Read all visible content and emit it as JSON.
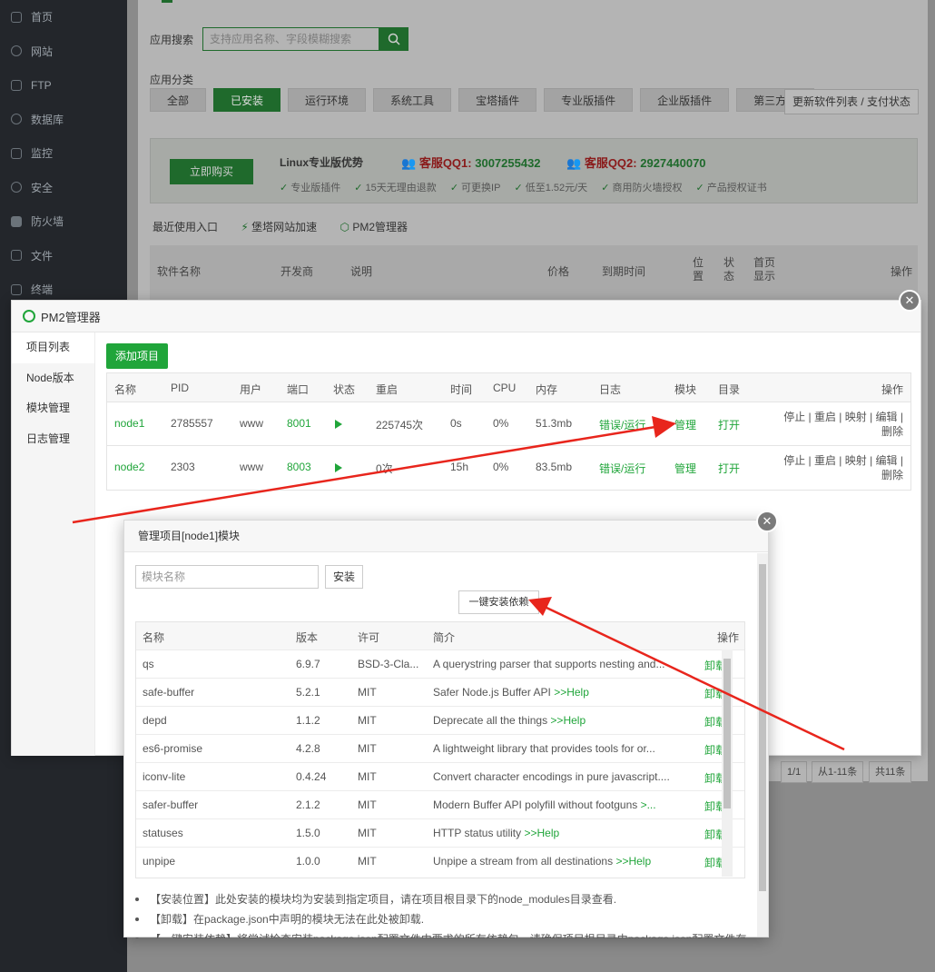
{
  "sidebar": {
    "items": [
      {
        "label": "首页",
        "icon": "home-icon"
      },
      {
        "label": "网站",
        "icon": "globe-icon"
      },
      {
        "label": "FTP",
        "icon": "ftp-icon"
      },
      {
        "label": "数据库",
        "icon": "database-icon"
      },
      {
        "label": "监控",
        "icon": "monitor-icon"
      },
      {
        "label": "安全",
        "icon": "shield-icon"
      },
      {
        "label": "防火墙",
        "icon": "firewall-icon"
      },
      {
        "label": "文件",
        "icon": "folder-icon"
      },
      {
        "label": "终端",
        "icon": "terminal-icon"
      }
    ]
  },
  "store": {
    "search_label": "应用搜索",
    "search_placeholder": "支持应用名称、字段模糊搜索",
    "category_label": "应用分类",
    "categories": [
      "全部",
      "已安装",
      "运行环境",
      "系统工具",
      "宝塔插件",
      "专业版插件",
      "企业版插件",
      "第三方应"
    ],
    "update_button": "更新软件列表 / 支付状态",
    "promo": {
      "buy": "立即购买",
      "title": "Linux专业版优势",
      "qq1_label": "客服QQ1:",
      "qq1": "3007255432",
      "qq2_label": "客服QQ2:",
      "qq2": "2927440070",
      "features": [
        "专业版插件",
        "15天无理由退款",
        "可更换IP",
        "低至1.52元/天",
        "商用防火墙授权",
        "产品授权证书"
      ]
    },
    "recent_label": "最近使用入口",
    "recent": [
      "堡塔网站加速",
      "PM2管理器"
    ],
    "table_headers": [
      "软件名称",
      "开发商",
      "说明",
      "价格",
      "到期时间",
      "位置",
      "状态",
      "首页显示",
      "操作"
    ]
  },
  "pm2": {
    "title": "PM2管理器",
    "menu": [
      "项目列表",
      "Node版本",
      "模块管理",
      "日志管理"
    ],
    "add_button": "添加项目",
    "headers": [
      "名称",
      "PID",
      "用户",
      "端口",
      "状态",
      "重启",
      "时间",
      "CPU",
      "内存",
      "日志",
      "模块",
      "目录",
      "操作"
    ],
    "rows": [
      {
        "name": "node1",
        "pid": "2785557",
        "user": "www",
        "port": "8001",
        "restart": "225745次",
        "time": "0s",
        "cpu": "0%",
        "mem": "51.3mb",
        "log": "错误/运行",
        "module": "管理",
        "dir": "打开",
        "ops1": "停止 | 重启 | 映射 | 编辑 |",
        "ops2": "删除"
      },
      {
        "name": "node2",
        "pid": "2303",
        "user": "www",
        "port": "8003",
        "restart": "0次",
        "time": "15h",
        "cpu": "0%",
        "mem": "83.5mb",
        "log": "错误/运行",
        "module": "管理",
        "dir": "打开",
        "ops1": "停止 | 重启 | 映射 | 编辑 |",
        "ops2": "删除"
      }
    ]
  },
  "pager": {
    "page": "1/1",
    "range": "从1-11条",
    "total": "共11条"
  },
  "module_dialog": {
    "title": "管理项目[node1]模块",
    "input_placeholder": "模块名称",
    "install_button": "安装",
    "one_key_button": "一键安装依赖",
    "headers": [
      "名称",
      "版本",
      "许可",
      "简介",
      "操作"
    ],
    "rows": [
      {
        "name": "qs",
        "version": "6.9.7",
        "license": "BSD-3-Cla...",
        "desc": "A querystring parser that supports nesting and...",
        "help": "",
        "op": "卸载"
      },
      {
        "name": "safe-buffer",
        "version": "5.2.1",
        "license": "MIT",
        "desc": "Safer Node.js Buffer API ",
        "help": ">>Help",
        "op": "卸载"
      },
      {
        "name": "depd",
        "version": "1.1.2",
        "license": "MIT",
        "desc": "Deprecate all the things ",
        "help": ">>Help",
        "op": "卸载"
      },
      {
        "name": "es6-promise",
        "version": "4.2.8",
        "license": "MIT",
        "desc": "A lightweight library that provides tools for or...",
        "help": "",
        "op": "卸载"
      },
      {
        "name": "iconv-lite",
        "version": "0.4.24",
        "license": "MIT",
        "desc": "Convert character encodings in pure javascript....",
        "help": "",
        "op": "卸载"
      },
      {
        "name": "safer-buffer",
        "version": "2.1.2",
        "license": "MIT",
        "desc": "Modern Buffer API polyfill without footguns ",
        "help": ">...",
        "op": "卸载"
      },
      {
        "name": "statuses",
        "version": "1.5.0",
        "license": "MIT",
        "desc": "HTTP status utility ",
        "help": ">>Help",
        "op": "卸载"
      },
      {
        "name": "unpipe",
        "version": "1.0.0",
        "license": "MIT",
        "desc": "Unpipe a stream from all destinations ",
        "help": ">>Help",
        "op": "卸载"
      }
    ],
    "notes": [
      "【安装位置】此处安装的模块均为安装到指定项目，请在项目根目录下的node_modules目录查看.",
      "【卸载】在package.json中声明的模块无法在此处被卸载.",
      "【一键安装依赖】将尝试检查安装package.json配置文件中要求的所有依赖包，请确保项目根目录中package.json配置文件存"
    ]
  },
  "colors": {
    "accent": "#20a53a",
    "arrow": "#e8251c"
  }
}
